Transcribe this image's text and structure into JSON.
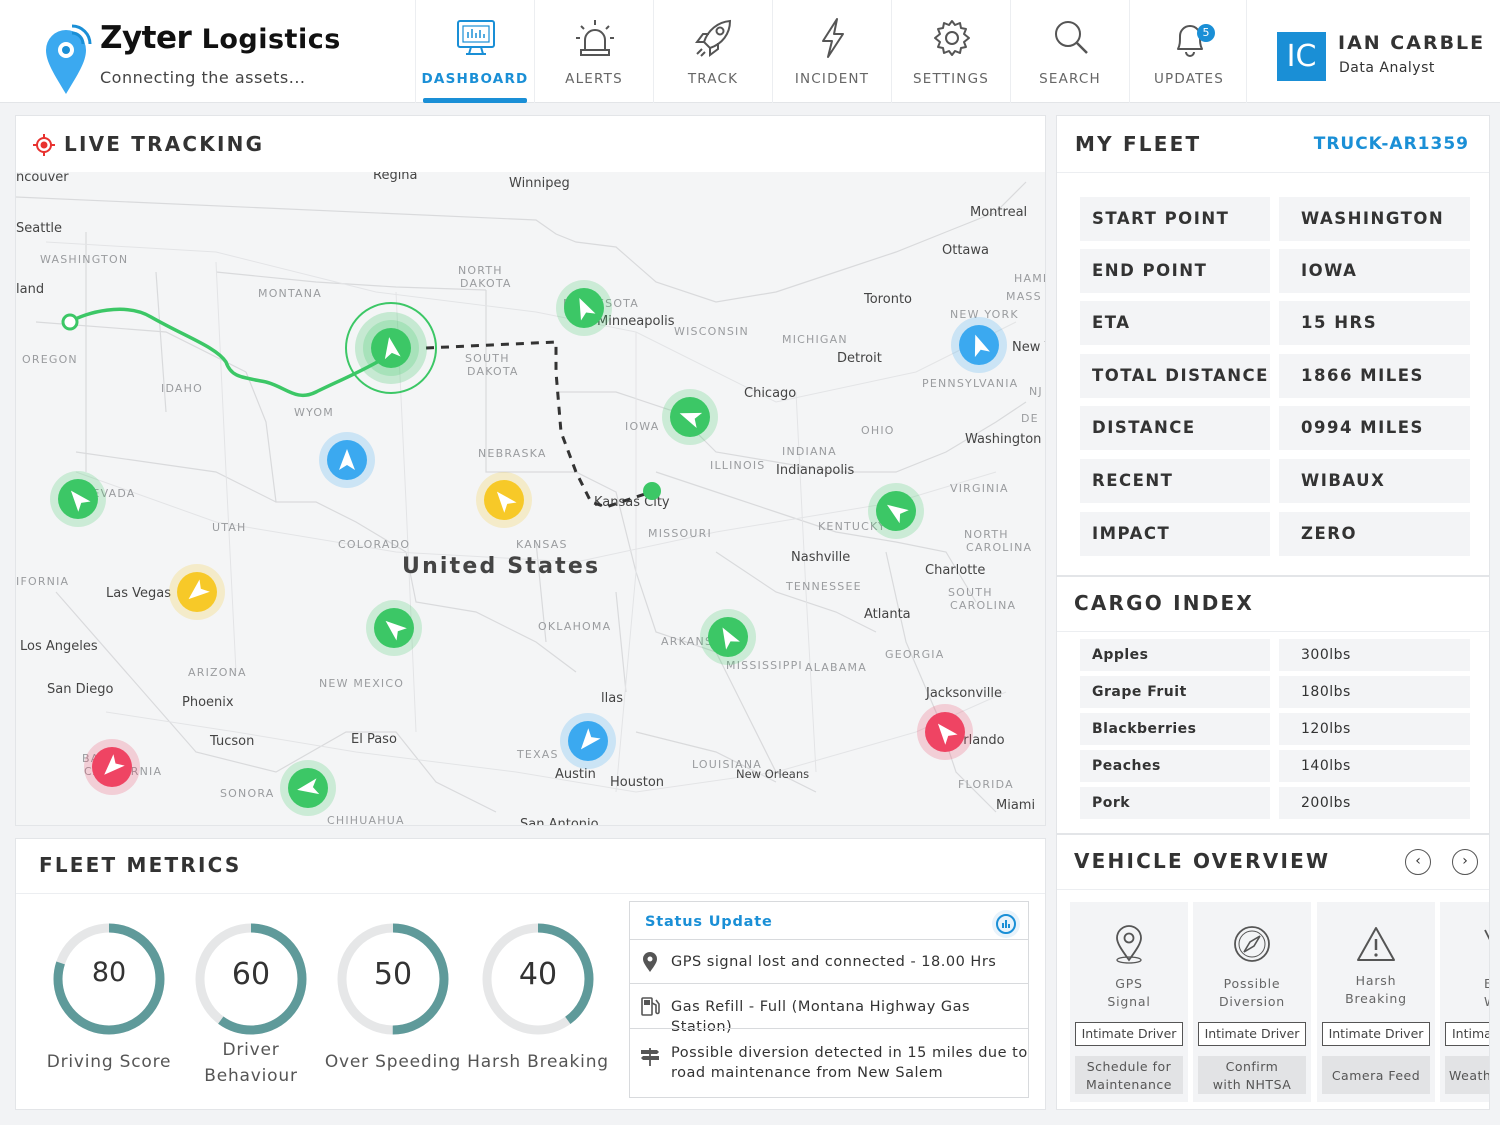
{
  "brand": {
    "name": "Zyter",
    "name_suffix": "Logistics",
    "tagline": "Connecting the assets..."
  },
  "nav": [
    {
      "label": "DASHBOARD",
      "icon": "dashboard-monitor-icon",
      "active": true
    },
    {
      "label": "ALERTS",
      "icon": "alarm-siren-icon",
      "active": false
    },
    {
      "label": "TRACK",
      "icon": "rocket-icon",
      "active": false
    },
    {
      "label": "INCIDENT",
      "icon": "lightning-bolt-icon",
      "active": false
    },
    {
      "label": "SETTINGS",
      "icon": "gear-icon",
      "active": false
    },
    {
      "label": "SEARCH",
      "icon": "search-icon",
      "active": false
    },
    {
      "label": "UPDATES",
      "icon": "bell-icon",
      "active": false,
      "badge": "5"
    }
  ],
  "user": {
    "initials": "IC",
    "name": "IAN CARBLE",
    "role": "Data Analyst"
  },
  "live_tracking": {
    "title": "LIVE TRACKING",
    "country_label": "United States",
    "cities": [
      "ncouver",
      "Seattle",
      "land",
      "Regina",
      "Winnipeg",
      "Montreal",
      "Ottawa",
      "Toronto",
      "Minneapolis",
      "Detroit",
      "Chicago",
      "New Y",
      "Washington",
      "Indianapolis",
      "Kansas City",
      "Nashville",
      "Charlotte",
      "Atlanta",
      "Las Vegas",
      "Los Angeles",
      "San Diego",
      "Phoenix",
      "Tucson",
      "El Paso",
      "Austin",
      "Houston",
      "New Orleans",
      "Jacksonville",
      "Orlando",
      "Miami",
      "San Antonio",
      "llas"
    ],
    "regions": [
      "WASHINGTON",
      "MONTANA",
      "NORTH DAKOTA",
      "MINNESOTA",
      "WISCONSIN",
      "MICHIGAN",
      "OREGON",
      "IDAHO",
      "WYOM",
      "SOUTH DAKOTA",
      "IOWA",
      "NEBRASKA",
      "NEVADA",
      "UTAH",
      "COLORADO",
      "KANSAS",
      "MISSOURI",
      "ILLINOIS",
      "INDIANA",
      "OHIO",
      "PENNSYLVANIA",
      "NEW YORK",
      "VIRGINIA",
      "KENTUCKY",
      "NORTH CAROLINA",
      "SOUTH CAROLINA",
      "TENNESSEE",
      "IFORNIA",
      "ARIZONA",
      "NEW MEXICO",
      "OKLAHOMA",
      "ARKANSAS",
      "MISSISSIPPI",
      "ALABAMA",
      "GEORGIA",
      "TEXAS",
      "LOUISIANA",
      "FLORIDA",
      "BAJA CALIFORNIA",
      "SONORA",
      "CHIHUAHUA",
      "HAMI",
      "MASS",
      "NJ",
      "DE"
    ],
    "colors": {
      "green": "#3cc766",
      "blue": "#3ba9f0",
      "yellow": "#f7c928",
      "red": "#ef4463",
      "route": "#3cc766"
    }
  },
  "fleet": {
    "title": "MY FLEET",
    "truck_id": "TRUCK-AR1359",
    "rows": [
      {
        "key": "START POINT",
        "value": "WASHINGTON"
      },
      {
        "key": "END POINT",
        "value": "IOWA"
      },
      {
        "key": "ETA",
        "value": "15 HRS"
      },
      {
        "key": "TOTAL DISTANCE",
        "value": "1866 MILES"
      },
      {
        "key": "DISTANCE COVERED",
        "value": "0994 MILES"
      },
      {
        "key": "RECENT LOCATION",
        "value": "WIBAUX"
      },
      {
        "key": "IMPACT",
        "value": "ZERO"
      }
    ]
  },
  "cargo": {
    "title": "CARGO INDEX",
    "rows": [
      {
        "item": "Apples",
        "weight": "300lbs"
      },
      {
        "item": "Grape Fruit",
        "weight": "180lbs"
      },
      {
        "item": "Blackberries",
        "weight": "120lbs"
      },
      {
        "item": "Peaches",
        "weight": "140lbs"
      },
      {
        "item": "Pork",
        "weight": "200lbs"
      }
    ]
  },
  "vehicle_overview": {
    "title": "VEHICLE OVERVIEW",
    "prev": "‹",
    "next": "›",
    "cards": [
      {
        "name": "GPS\nSignal",
        "icon": "map-pin-icon",
        "badge": "Intimate Driver",
        "action": "Schedule for\nMaintenance"
      },
      {
        "name": "Possible\nDiversion",
        "icon": "compass-icon",
        "badge": "Intimate Driver",
        "action": "Confirm\nwith NHTSA"
      },
      {
        "name": "Harsh\nBreaking",
        "icon": "warning-triangle-icon",
        "badge": "Intimate Driver",
        "action": "Camera Feed"
      },
      {
        "name": "E\nWe",
        "icon": "weather-icon",
        "badge": "Intima",
        "action": "Weath"
      }
    ]
  },
  "metrics": {
    "title": "FLEET METRICS",
    "gauges": [
      {
        "value": "80",
        "percent": 80,
        "label": "Driving Score"
      },
      {
        "value": "60",
        "percent": 60,
        "label": "Driver\nBehaviour"
      },
      {
        "value": "50",
        "percent": 50,
        "label": "Over Speeding"
      },
      {
        "value": "40",
        "percent": 40,
        "label": "Harsh Breaking"
      }
    ],
    "gauge_color": "#5f9a9a"
  },
  "status": {
    "title": "Status Update",
    "items": [
      {
        "icon": "map-pin-icon",
        "text": "GPS signal lost and connected - 18.00 Hrs"
      },
      {
        "icon": "fuel-pump-icon",
        "text": "Gas Refill - Full (Montana Highway Gas Station)"
      },
      {
        "icon": "road-sign-icon",
        "text": "Possible diversion detected in 15 miles due to\nroad maintenance from New Salem"
      }
    ]
  }
}
